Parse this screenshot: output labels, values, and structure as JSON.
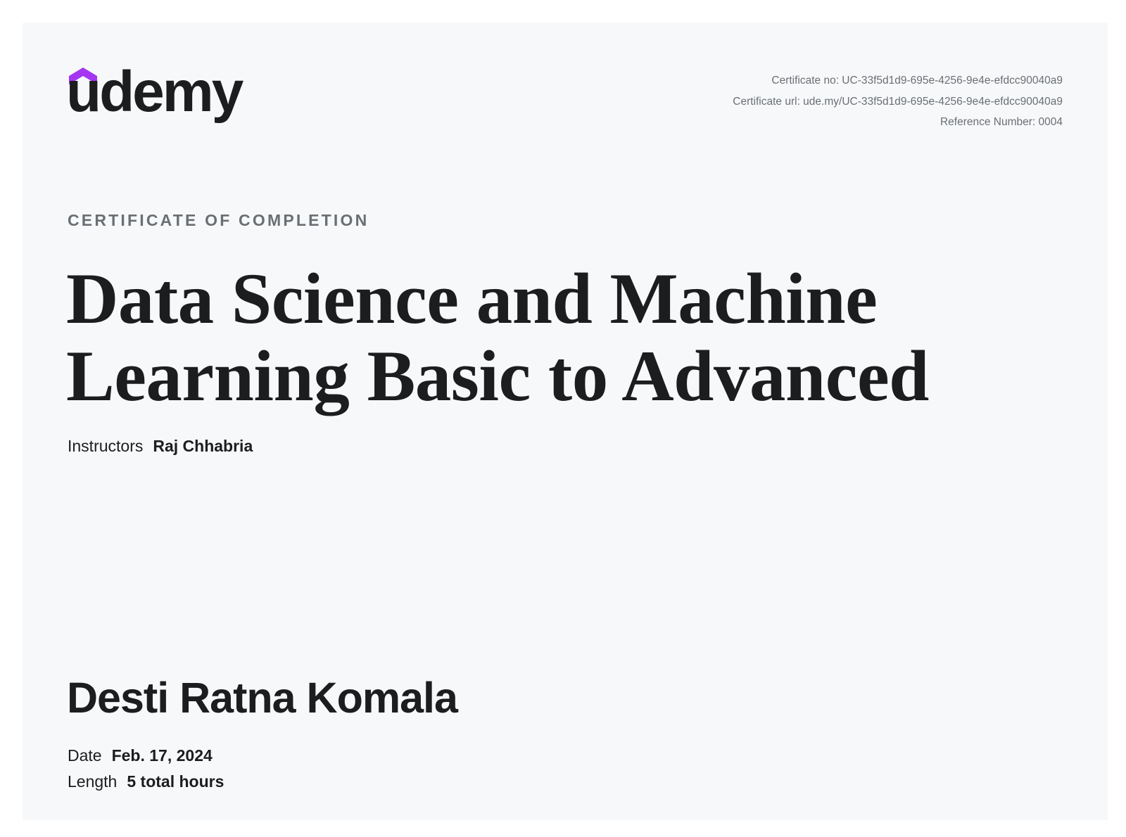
{
  "brand": {
    "wordmark": "udemy",
    "accent_color": "#a435f0",
    "text_color": "#1c1d1f",
    "icon": "graduation-cap-icon"
  },
  "certificate_meta": {
    "number": "Certificate no: UC-33f5d1d9-695e-4256-9e4e-efdcc90040a9",
    "url": "Certificate url: ude.my/UC-33f5d1d9-695e-4256-9e4e-efdcc90040a9",
    "reference": "Reference Number: 0004"
  },
  "eyebrow": "CERTIFICATE OF COMPLETION",
  "course": {
    "title_line1": "Data Science and Machine",
    "title_line2": "Learning Basic to Advanced"
  },
  "instructors": {
    "label": "Instructors",
    "name": "Raj Chhabria"
  },
  "student_name": "Desti Ratna Komala",
  "details": {
    "date_label": "Date",
    "date_value": "Feb. 17, 2024",
    "length_label": "Length",
    "length_value": "5 total hours"
  },
  "colors": {
    "background": "#f7f8fa",
    "muted_text": "#6a6f73"
  }
}
